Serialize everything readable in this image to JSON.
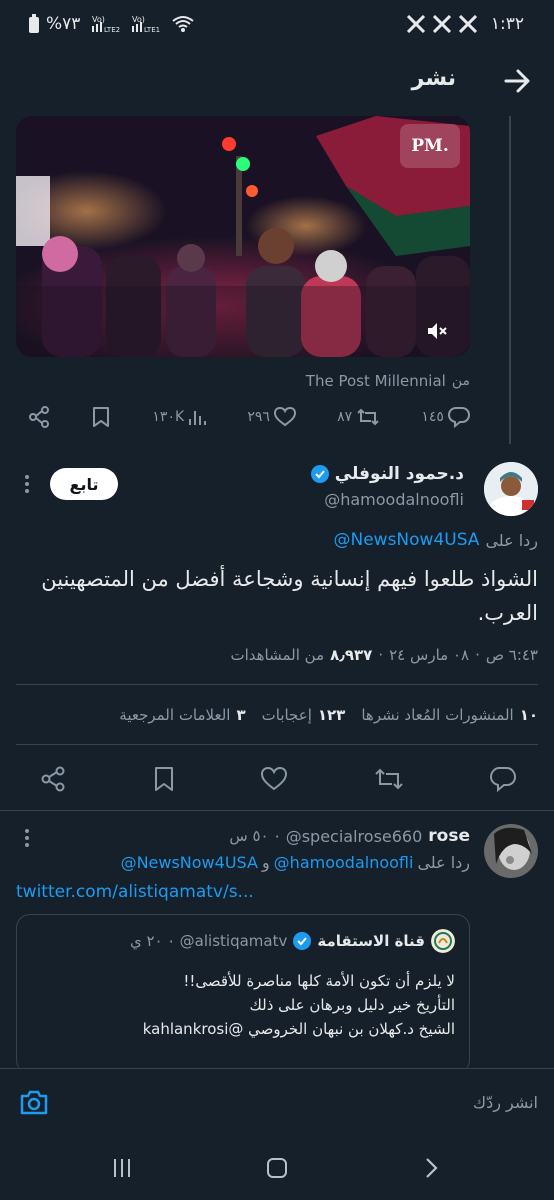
{
  "status_bar": {
    "time": "١:٣٢",
    "battery": "%٧٣",
    "lte1": "LTE1",
    "lte2": "LTE2",
    "vo": "Vo)",
    "app_icons": [
      "x-icon",
      "x-icon",
      "x-icon"
    ]
  },
  "header": {
    "title": "نشر"
  },
  "quoted_media": {
    "watermark": "PM.",
    "source_prefix": "من",
    "source_name": "The Post Millennial"
  },
  "parent_actions": {
    "replies": "١٤٥",
    "retweets": "٨٧",
    "likes": "٢٩٦",
    "views": "١٣٠K"
  },
  "main_tweet": {
    "author_name": "د.حمود النوفلي",
    "handle": "@hamoodalnoofli",
    "follow_label": "تابع",
    "reply_to_prefix": "ردا على",
    "reply_to": "@NewsNow4USA",
    "text": "الشواذ طلعوا فيهم إنسانية وشجاعة أفضل من المتصهينين العرب.",
    "time": "٦:٤٣ ص",
    "date": "٠٨ مارس ٢٤",
    "views_count": "٨٫٩٣٧",
    "views_label": "من المشاهدات",
    "stats": {
      "retweets_count": "١٠",
      "retweets_label": "المنشورات المُعاد نشرها",
      "likes_count": "١٢٣",
      "likes_label": "إعجابات",
      "bookmarks_count": "٣",
      "bookmarks_label": "العلامات المرجعية"
    }
  },
  "reply_tweet": {
    "author_name": "rose",
    "handle": "@specialrose660",
    "time": "٥٠ س",
    "reply_to_prefix": "ردا على",
    "reply_to_1": "@hamoodalnoofli",
    "reply_to_and": "و",
    "reply_to_2": "@NewsNow4USA",
    "link": "twitter.com/alistiqamatv/s...",
    "quote": {
      "author_name": "قناة الاستقامة",
      "handle": "@alistiqamatv",
      "time": "٢٠ ي",
      "line1": "لا يلزم أن تكون الأمة كلها مناصرة للأقصى!!",
      "line2": "التأريخ خير دليل وبرهان على ذلك",
      "line3": "الشيخ د.كهلان بن نبهان الخروصي @kahlankrosi"
    }
  },
  "composer": {
    "placeholder": "انشر ردّك"
  },
  "colors": {
    "background": "#15202b",
    "accent": "#1d9bf0",
    "text": "#e7e9ea",
    "muted": "#8b98a5",
    "divider": "#38444d"
  }
}
